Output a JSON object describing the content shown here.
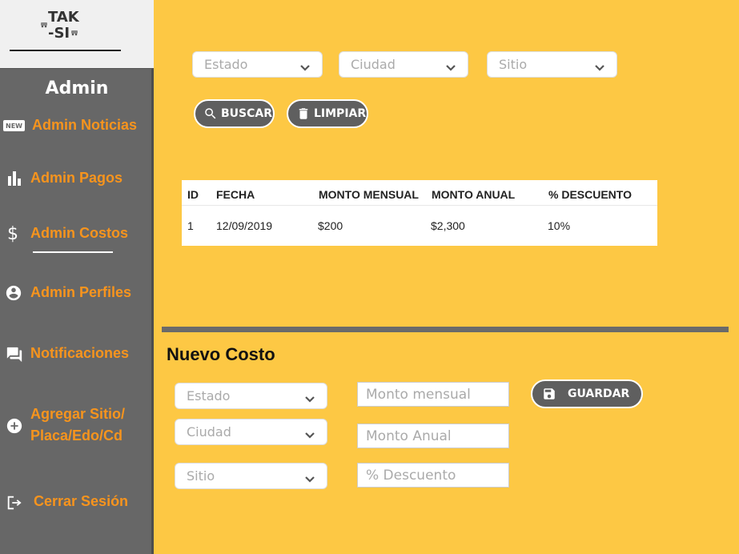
{
  "logo": {
    "line1": "TAK",
    "line2": "-SI"
  },
  "sidebar": {
    "title": "Admin",
    "items": [
      {
        "label": "Admin Noticias",
        "icon": "new-badge-icon"
      },
      {
        "label": "Admin Pagos",
        "icon": "bar-chart-icon"
      },
      {
        "label": "Admin Costos",
        "icon": "dollar-icon",
        "active": true
      },
      {
        "label": "Admin Perfiles",
        "icon": "account-circle-icon"
      },
      {
        "label": "Notificaciones",
        "icon": "chat-bubble-icon"
      },
      {
        "label_line1": "Agregar Sitio/",
        "label_line2": "Placa/Edo/Cd",
        "icon": "add-circle-icon"
      },
      {
        "label": "Cerrar Sesión",
        "icon": "exit-icon"
      }
    ],
    "new_badge_text": "NEW"
  },
  "filters": {
    "estado": "Estado",
    "ciudad": "Ciudad",
    "sitio": "Sitio",
    "buscar_label": "BUSCAR",
    "limpiar_label": "LIMPIAR"
  },
  "table": {
    "headers": [
      "ID",
      "FECHA",
      "MONTO MENSUAL",
      "MONTO ANUAL",
      "% DESCUENTO"
    ],
    "rows": [
      [
        "1",
        "12/09/2019",
        "$200",
        "$2,300",
        "10%"
      ]
    ]
  },
  "nuevo_costo": {
    "title": "Nuevo Costo",
    "estado": "Estado",
    "ciudad": "Ciudad",
    "sitio": "Sitio",
    "monto_mensual_placeholder": "Monto mensual",
    "monto_anual_placeholder": "Monto Anual",
    "descuento_placeholder": "% Descuento",
    "guardar_label": "GUARDAR"
  },
  "colors": {
    "background": "#fdc844",
    "sidebar": "#676767",
    "accent": "#f7941d",
    "button": "#5f5f5f"
  }
}
